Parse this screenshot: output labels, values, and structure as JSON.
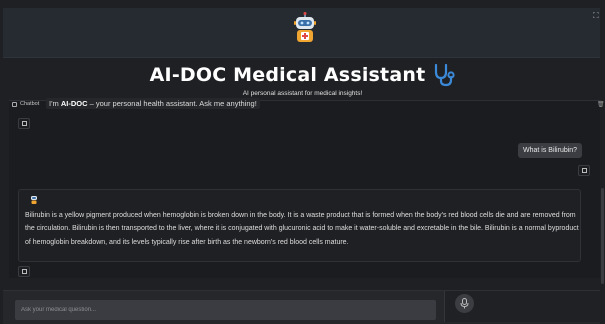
{
  "header": {
    "title": "AI-DOC Medical Assistant",
    "subtitle": "AI personal assistant for medical insights!"
  },
  "chat": {
    "label": "Chatbot",
    "intro_prefix": "I'm ",
    "intro_brand": "AI-DOC",
    "intro_suffix": " – your personal health assistant. Ask me anything!",
    "user_message": "What is Bilirubin?",
    "bot_message": "Bilirubin is a yellow pigment produced when hemoglobin is broken down in the body. It is a waste product that is formed when the body's red blood cells die and are removed from the circulation. Bilirubin is then transported to the liver, where it is conjugated with glucuronic acid to make it water-soluble and excretable in the bile. Bilirubin is a normal byproduct of hemoglobin breakdown, and its levels typically rise after birth as the newborn's red blood cells mature."
  },
  "input": {
    "placeholder": "Ask your medical question..."
  },
  "icons": {
    "logo": "robot-doctor-icon",
    "title_icon": "stethoscope-icon",
    "fullscreen": "fullscreen-icon",
    "copy": "copy-icon",
    "delete": "trash-icon",
    "send": "send-icon",
    "bot_avatar": "robot-icon"
  },
  "colors": {
    "background": "#1f2023",
    "accent_blue": "#3b8ad9",
    "user_bubble": "#3b3d42"
  }
}
